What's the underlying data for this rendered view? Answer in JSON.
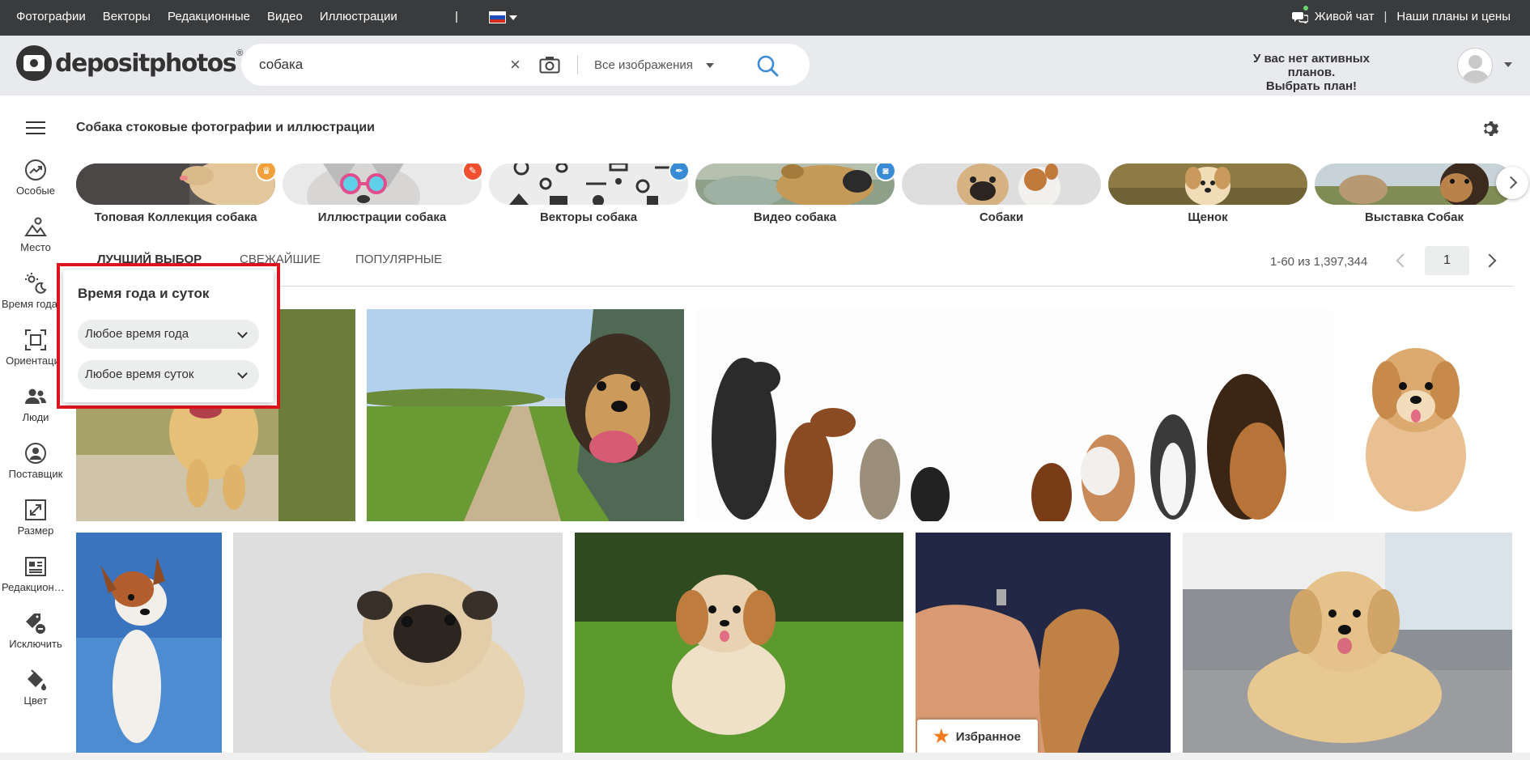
{
  "topbar": {
    "nav": [
      "Фотографии",
      "Векторы",
      "Редакционные",
      "Видео",
      "Иллюстрации"
    ],
    "separator": "|",
    "live_chat": "Живой чат",
    "divider": "|",
    "plans": "Наши планы и цены"
  },
  "header": {
    "logo_text": "depositphotos",
    "logo_reg": "®",
    "search_value": "собака",
    "clear": "×",
    "type_label": "Все изображения",
    "plan_line1": "У вас нет активных планов.",
    "plan_line2": "Выбрать план!"
  },
  "sidebar": [
    {
      "label": "Особые",
      "icon": "trend-icon"
    },
    {
      "label": "Место",
      "icon": "place-icon"
    },
    {
      "label": "Время года и суток",
      "icon": "season-icon"
    },
    {
      "label": "Ориентация",
      "icon": "orientation-icon"
    },
    {
      "label": "Люди",
      "icon": "people-icon"
    },
    {
      "label": "Поставщик",
      "icon": "contributor-icon"
    },
    {
      "label": "Размер",
      "icon": "size-icon"
    },
    {
      "label": "Редакционные",
      "icon": "editorial-icon"
    },
    {
      "label": "Исключить",
      "icon": "exclude-icon"
    },
    {
      "label": "Цвет",
      "icon": "color-icon"
    }
  ],
  "page_title": "Собака стоковые фотографии и иллюстрации",
  "categories": [
    {
      "label": "Топовая Коллекция собака",
      "badge": "crown-icon",
      "badge_color": "#f1a03a"
    },
    {
      "label": "Иллюстрации собака",
      "badge": "brush-icon",
      "badge_color": "#f0502f"
    },
    {
      "label": "Векторы собака",
      "badge": "pen-icon",
      "badge_color": "#3a8bd6"
    },
    {
      "label": "Видео собака",
      "badge": "camera-icon",
      "badge_color": "#3a8bd6"
    },
    {
      "label": "Собаки"
    },
    {
      "label": "Щенок"
    },
    {
      "label": "Выставка Собак"
    }
  ],
  "tabs": [
    "Лучший выбор",
    "Свежайшие",
    "Популярные"
  ],
  "active_tab": "Лучший выбор",
  "pagination": {
    "count": "1-60 из 1,397,344",
    "page": "1"
  },
  "favorites": {
    "label": "Избранное"
  },
  "popup": {
    "title": "Время года и суток",
    "season": "Любое время года",
    "daytime": "Любое время суток"
  },
  "colors": {
    "accent": "#3a8bd6",
    "highlight": "#e0141e",
    "topbar": "#3a3b3c",
    "header": "#e8eaed",
    "favorite_star": "#f47a20"
  }
}
